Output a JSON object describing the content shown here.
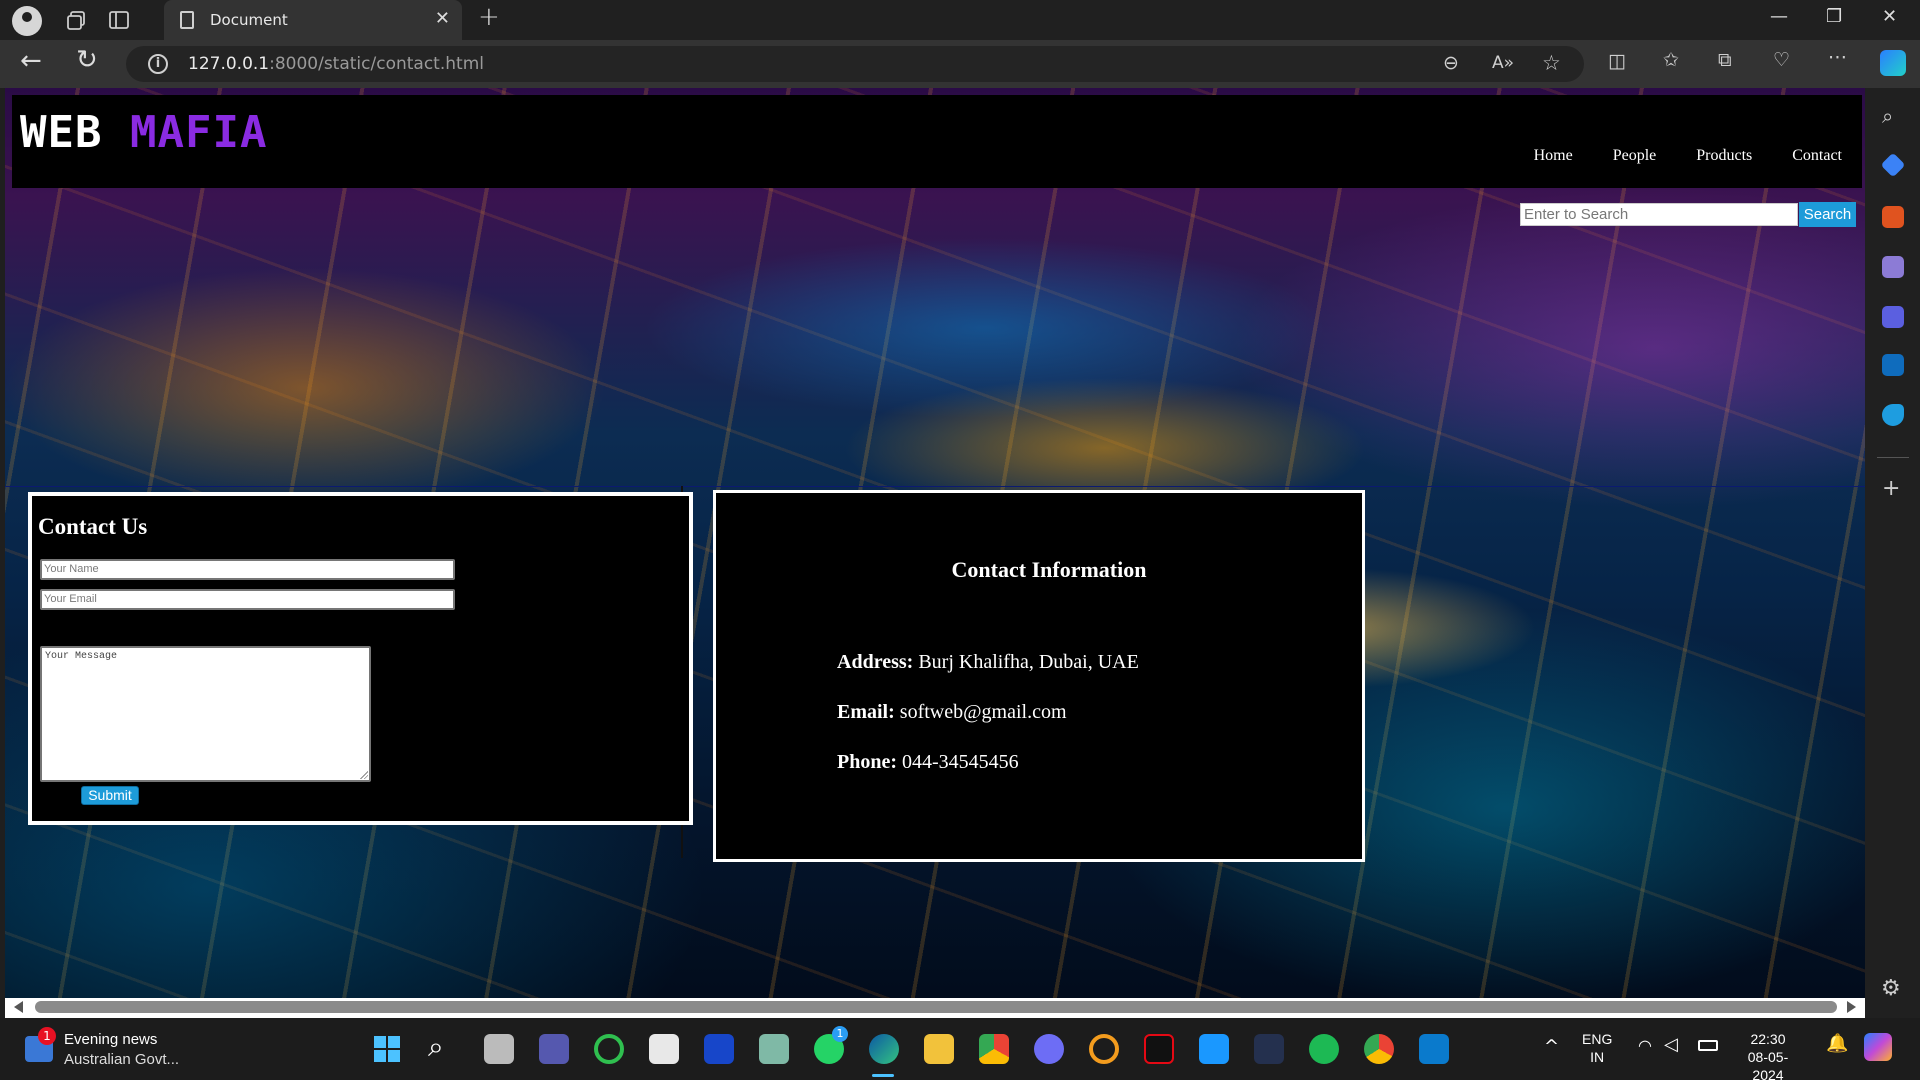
{
  "browser": {
    "tab_title": "Document",
    "url_host": "127.0.0.1",
    "url_rest": ":8000/static/contact.html"
  },
  "site": {
    "logo_part1": "WEB",
    "logo_part2": "MAFIA",
    "nav": [
      "Home",
      "People",
      "Products",
      "Contact"
    ],
    "search_placeholder": "Enter to Search",
    "search_button": "Search"
  },
  "contact_form": {
    "title": "Contact Us",
    "name_placeholder": "Your Name",
    "email_placeholder": "Your Email",
    "message_placeholder": "Your Message",
    "submit_label": "Submit"
  },
  "contact_info": {
    "title": "Contact Information",
    "address_label": "Address:",
    "address_value": "Burj Khalifha, Dubai, UAE",
    "email_label": "Email:",
    "email_value": "softweb@gmail.com",
    "phone_label": "Phone:",
    "phone_value": "044-34545456"
  },
  "taskbar": {
    "news_title": "Evening news",
    "news_subtitle": "Australian Govt...",
    "news_badge": "1",
    "whatsapp_badge": "1",
    "lang_line1": "ENG",
    "lang_line2": "IN",
    "time": "22:30",
    "date": "08-05-2024"
  },
  "colors": {
    "logo_accent": "#8a2be2",
    "button_blue": "#1d9bd9"
  }
}
